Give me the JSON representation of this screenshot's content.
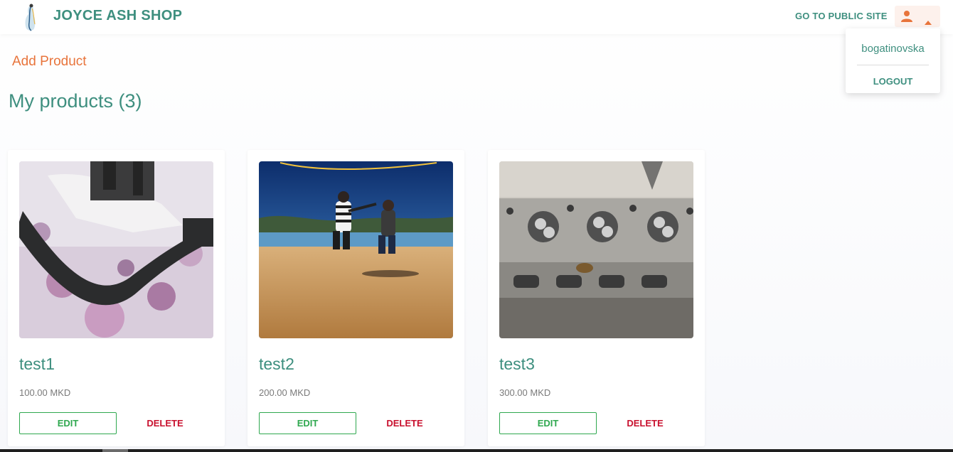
{
  "header": {
    "brand": "JOYCE ASH SHOP",
    "public_site_label": "GO TO PUBLIC SITE",
    "user_icon": "person-icon",
    "caret_icon": "caret-up-icon"
  },
  "user_menu": {
    "username": "bogatinovska",
    "logout_label": "LOGOUT"
  },
  "main": {
    "add_product_label": "Add Product",
    "title": "My products (3)"
  },
  "products": [
    {
      "name": "test1",
      "price": "100.00 MKD",
      "edit_label": "EDIT",
      "delete_label": "DELETE",
      "image": "black-pipe-on-floral-cloth-photo"
    },
    {
      "name": "test2",
      "price": "200.00 MKD",
      "edit_label": "EDIT",
      "delete_label": "DELETE",
      "image": "two-people-jumping-on-beach-photo"
    },
    {
      "name": "test3",
      "price": "300.00 MKD",
      "edit_label": "EDIT",
      "delete_label": "DELETE",
      "image": "engine-cylinder-head-photo"
    }
  ],
  "colors": {
    "brand_green": "#3e8f7f",
    "accent_orange": "#e8743b",
    "edit_green": "#2fa84f",
    "delete_red": "#c8102e"
  }
}
